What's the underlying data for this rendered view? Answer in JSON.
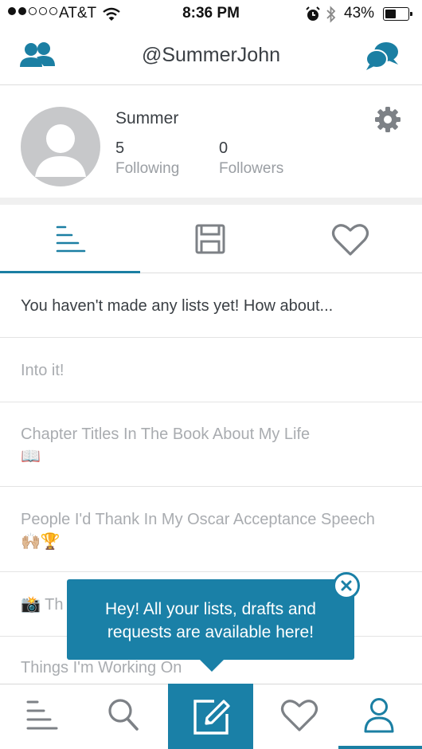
{
  "status_bar": {
    "carrier": "AT&T",
    "time": "8:36 PM",
    "battery": "43%",
    "battery_level": 0.43,
    "signal_bars_filled": 2,
    "signal_bars_total": 5
  },
  "header": {
    "username": "@SummerJohn",
    "left_icon": "friends-icon",
    "right_icon": "chat-bubbles-icon"
  },
  "profile": {
    "name": "Summer",
    "following_count": "5",
    "following_label": "Following",
    "followers_count": "0",
    "followers_label": "Followers",
    "settings_icon": "gear-icon"
  },
  "tabs": [
    {
      "icon": "lists-icon",
      "active": true
    },
    {
      "icon": "drafts-save-icon",
      "active": false
    },
    {
      "icon": "heart-icon",
      "active": false
    }
  ],
  "list": {
    "prompt": "You haven't made any lists yet! How about...",
    "suggestions": [
      {
        "text": "Into it!"
      },
      {
        "text": "Chapter Titles In The Book About My Life",
        "emoji": "📖"
      },
      {
        "text": "People I'd Thank In My Oscar Acceptance Speech",
        "emoji": "🙌🏼🏆"
      },
      {
        "text": "Th",
        "emoji_prefix": "📸"
      },
      {
        "text": "Things I'm Working On"
      }
    ]
  },
  "tooltip": {
    "line1": "Hey! All your lists, drafts and",
    "line2": "requests are available here!",
    "close_icon": "close-icon"
  },
  "bottom_nav": [
    {
      "icon": "feed-icon",
      "active": false
    },
    {
      "icon": "search-icon",
      "active": false
    },
    {
      "icon": "compose-icon",
      "active": false
    },
    {
      "icon": "heart-icon",
      "active": false
    },
    {
      "icon": "profile-icon",
      "active": true
    }
  ],
  "colors": {
    "accent": "#1a80a7",
    "text_dark": "#3a3f44",
    "text_muted": "#a9acb0"
  }
}
